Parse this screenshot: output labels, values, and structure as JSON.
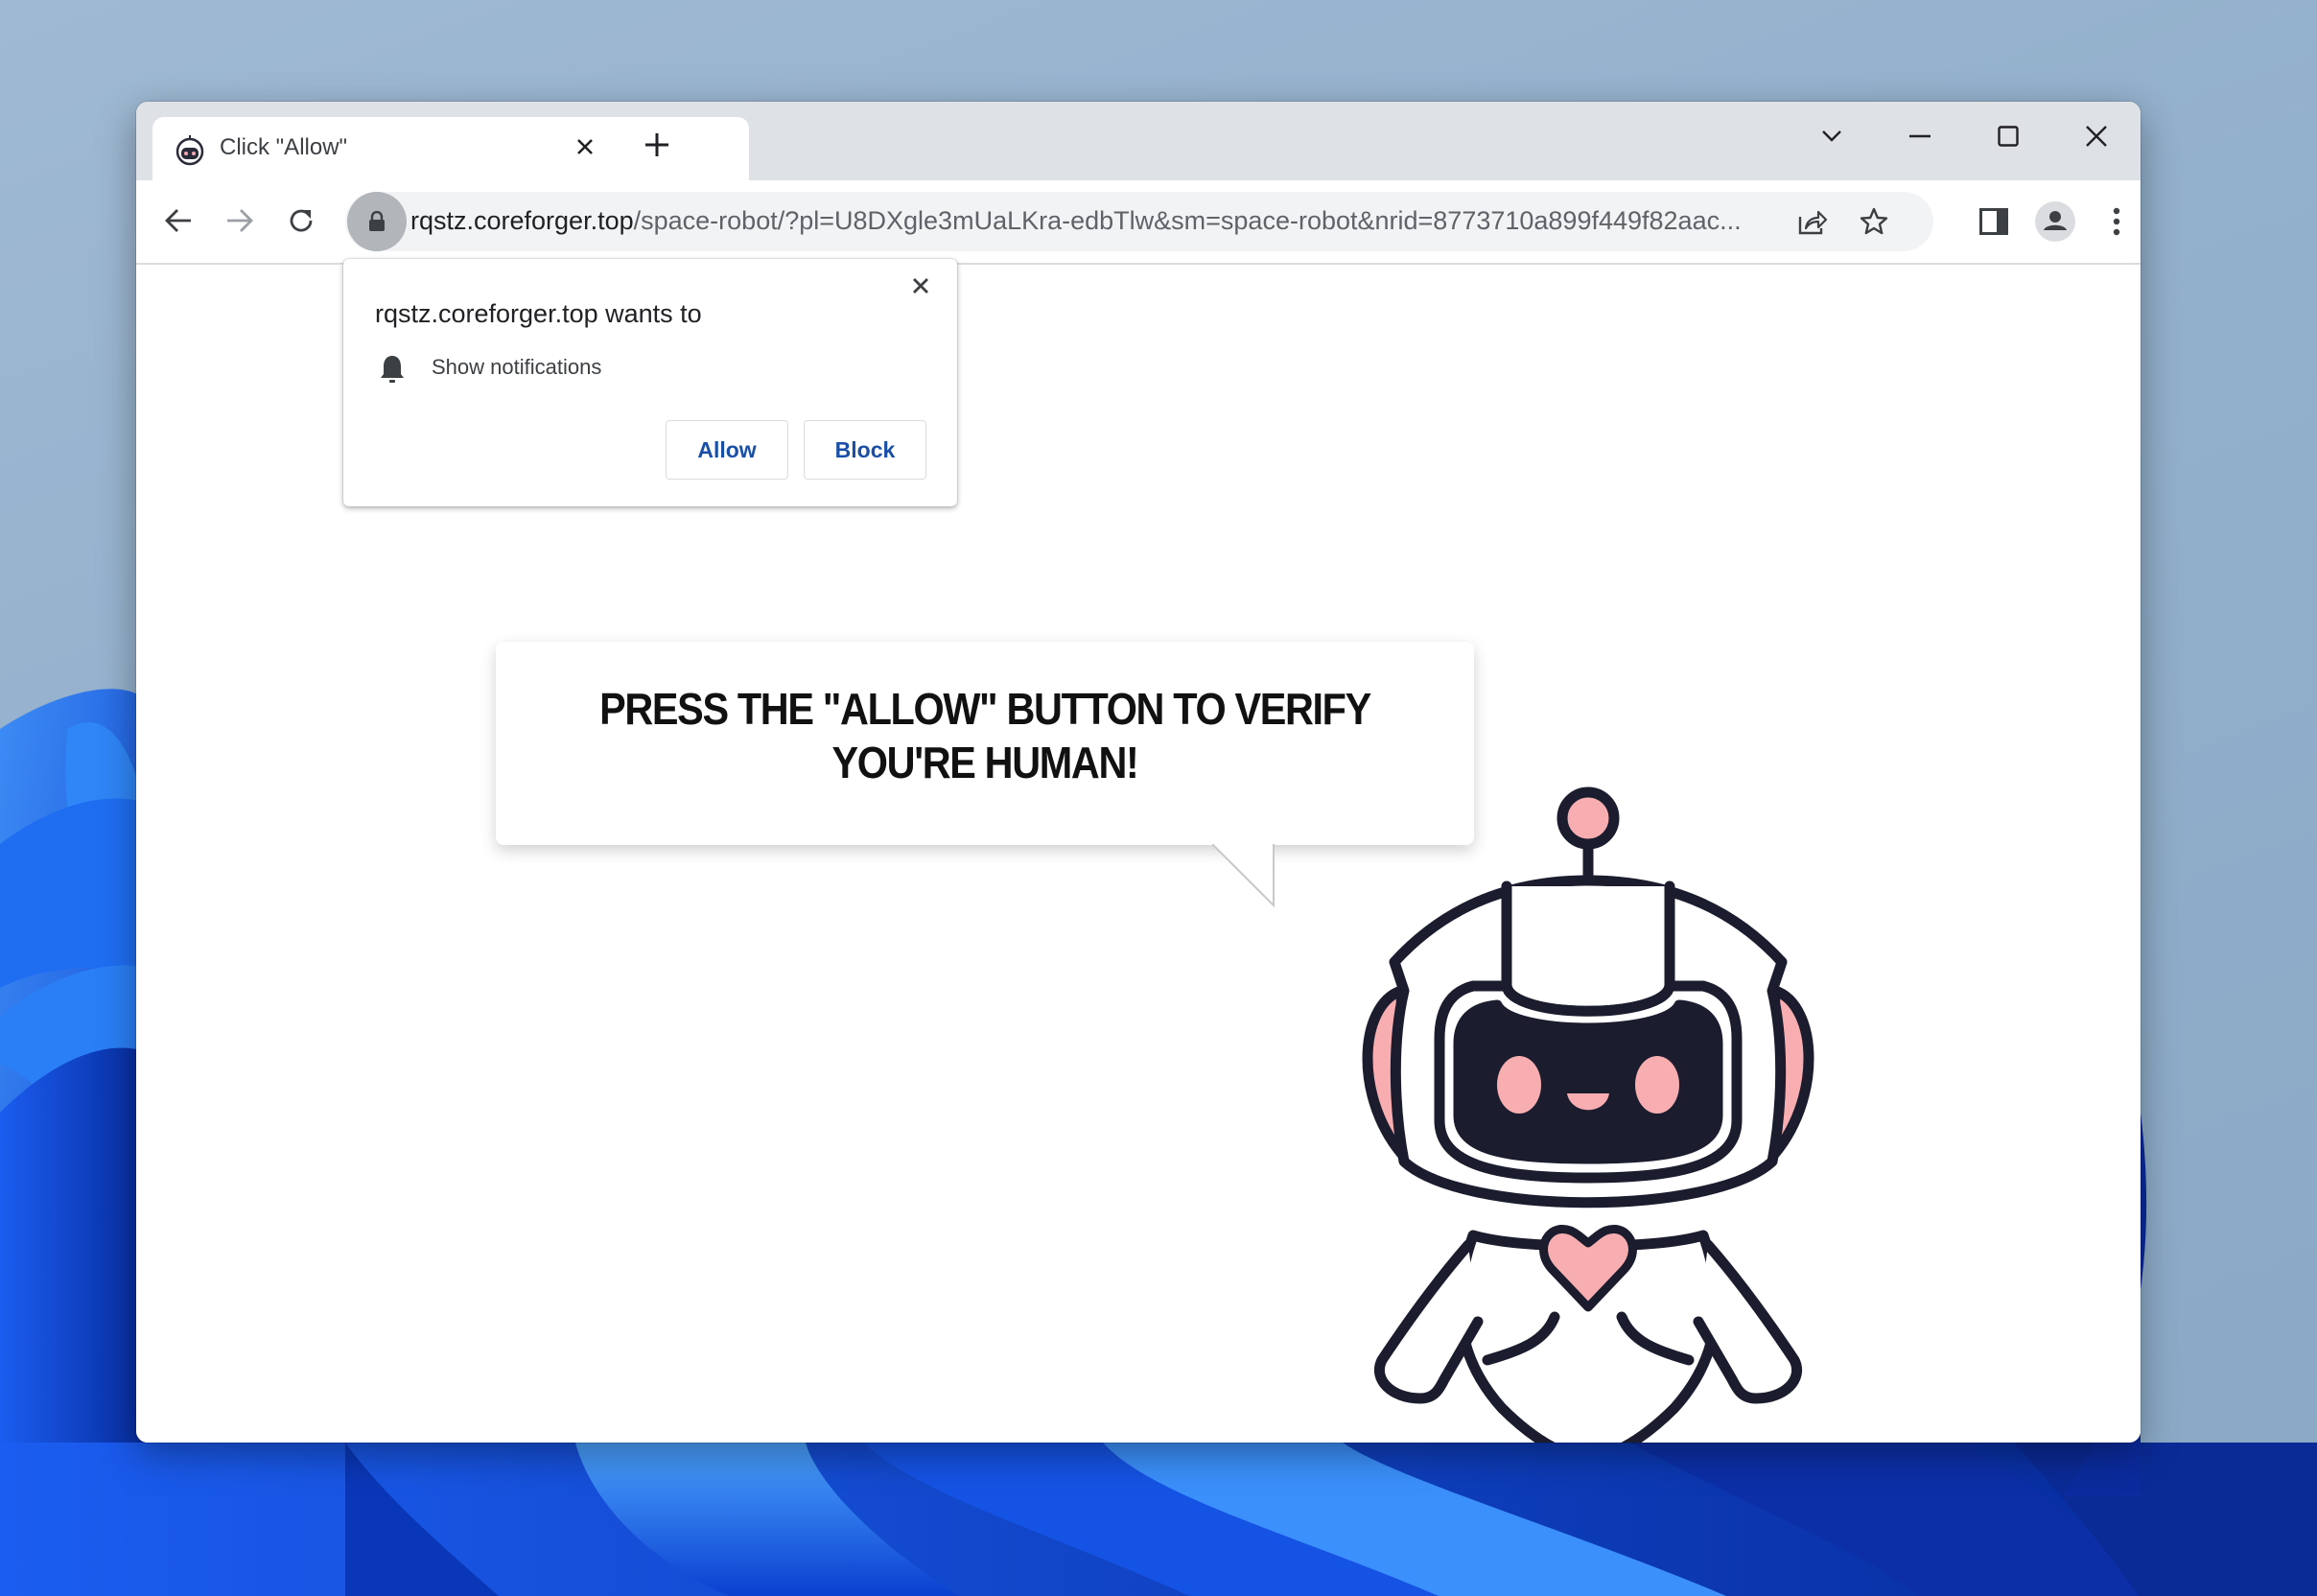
{
  "desktop": {
    "wallpaper": "windows-11-bloom-blue"
  },
  "browser": {
    "tab": {
      "title": "Click \"Allow\"",
      "favicon": "robot-icon",
      "close_icon": "close-icon"
    },
    "new_tab_icon": "plus-icon",
    "window_controls": [
      "tab-search-chevron-icon",
      "minimize-icon",
      "maximize-icon",
      "close-icon"
    ],
    "nav": {
      "back": "back-arrow-icon",
      "forward": "forward-arrow-icon",
      "reload": "reload-icon"
    },
    "address_bar": {
      "security_icon": "lock-icon",
      "host": "rqstz.coreforger.top",
      "path": "/space-robot/?pl=U8DXgle3mUaLKra-edbTlw&sm=space-robot&nrid=8773710a899f449f82aac..."
    },
    "omnibox_actions": [
      "share-icon",
      "bookmark-star-icon"
    ],
    "toolbar_actions": [
      "side-panel-icon",
      "profile-avatar-icon",
      "more-menu-icon"
    ]
  },
  "permission_prompt": {
    "title": "rqstz.coreforger.top wants to",
    "permission": "Show notifications",
    "permission_icon": "bell-icon",
    "allow_label": "Allow",
    "block_label": "Block",
    "close_icon": "close-icon"
  },
  "page": {
    "headline_line1": "PRESS THE \"ALLOW\" BUTTON TO VERIFY",
    "headline_line2": "YOU'RE HUMAN!",
    "illustration": "cute-robot-astronaut",
    "colors": {
      "outline": "#1b1d2e",
      "accent_pink": "#f8aeb0",
      "shadow": "#000000"
    }
  }
}
